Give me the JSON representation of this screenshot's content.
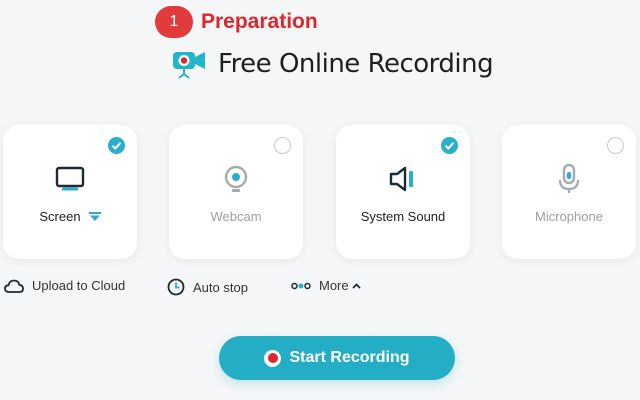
{
  "step": {
    "number": "1",
    "label": "Preparation"
  },
  "header": {
    "title": "Free Online Recording"
  },
  "cards": [
    {
      "label": "Screen",
      "checked": true
    },
    {
      "label": "Webcam",
      "checked": false
    },
    {
      "label": "System Sound",
      "checked": true
    },
    {
      "label": "Microphone",
      "checked": false
    }
  ],
  "options": {
    "upload": "Upload to Cloud",
    "auto_stop": "Auto stop",
    "more": "More"
  },
  "button": {
    "label": "Start Recording"
  },
  "colors": {
    "accent": "#23aec5",
    "red": "#e0262d",
    "inactive": "#9aa0a4"
  }
}
